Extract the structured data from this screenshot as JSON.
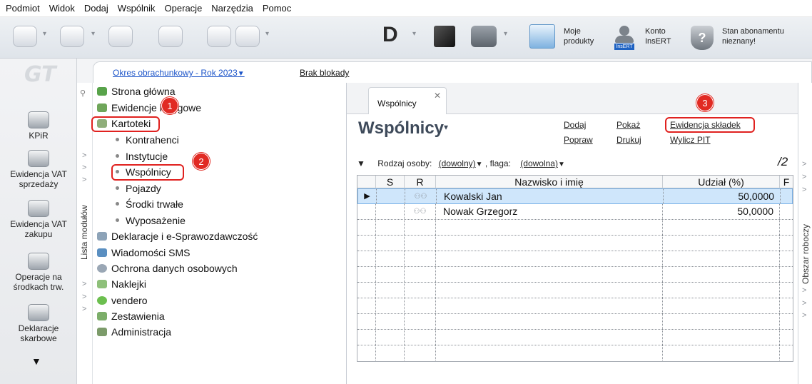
{
  "menu": [
    "Podmiot",
    "Widok",
    "Dodaj",
    "Wspólnik",
    "Operacje",
    "Narzędzia",
    "Pomoc"
  ],
  "toolbar": {
    "d_label": "D",
    "moje_produkty": "Moje\nprodukty",
    "moje_produkty_l1": "Moje",
    "moje_produkty_l2": "produkty",
    "konto_l1": "Konto",
    "konto_l2": "InsERT",
    "konto_badge": "InsERT",
    "stan_l1": "Stan abonamentu",
    "stan_l2": "nieznany!"
  },
  "leftpanel": {
    "logo": "GT",
    "items": [
      {
        "l1": "KPiR",
        "l2": ""
      },
      {
        "l1": "Ewidencja VAT",
        "l2": "sprzedaży"
      },
      {
        "l1": "Ewidencja VAT",
        "l2": "zakupu"
      },
      {
        "l1": "Operacje na",
        "l2": "środkach trw."
      },
      {
        "l1": "Deklaracje",
        "l2": "skarbowe"
      }
    ]
  },
  "info": {
    "okres": "Okres obrachunkowy - Rok 2023",
    "blokada": "Brak blokady"
  },
  "modbar_label": "Lista modułów",
  "tree": {
    "strona": "Strona główna",
    "ewidencje": "Ewidencje księgowe",
    "kartoteki": "Kartoteki",
    "kontrahenci": "Kontrahenci",
    "instytucje": "Instytucje",
    "wspolnicy": "Wspólnicy",
    "pojazdy": "Pojazdy",
    "srodki": "Środki trwałe",
    "wyposazenie": "Wyposażenie",
    "deklaracje": "Deklaracje i e-Sprawozdawczość",
    "sms": "Wiadomości SMS",
    "ochrona": "Ochrona danych osobowych",
    "naklejki": "Naklejki",
    "vendero": "vendero",
    "zestawienia": "Zestawienia",
    "administracja": "Administracja"
  },
  "badges": {
    "b1": "1",
    "b2": "2",
    "b3": "3"
  },
  "workspace": {
    "tab": "Wspólnicy",
    "title": "Wspólnicy",
    "actions": {
      "dodaj": "Dodaj",
      "popraw": "Popraw",
      "pokaz": "Pokaż",
      "drukuj": "Drukuj",
      "ewidencja": "Ewidencja składek",
      "wylicz": "Wylicz PIT"
    },
    "filter": {
      "rodzaj_label": "Rodzaj osoby:",
      "rodzaj_value": "(dowolny)",
      "flaga_label": ", flaga:",
      "flaga_value": "(dowolna)"
    },
    "counter": "/2"
  },
  "grid": {
    "headers": {
      "s": "S",
      "r": "R",
      "name": "Nazwisko i imię",
      "share": "Udział (%)",
      "f": "F"
    },
    "rows": [
      {
        "name": "Kowalski Jan",
        "share": "50,0000"
      },
      {
        "name": "Nowak Grzegorz",
        "share": "50,0000"
      }
    ]
  },
  "side_label": "Obszar roboczy"
}
